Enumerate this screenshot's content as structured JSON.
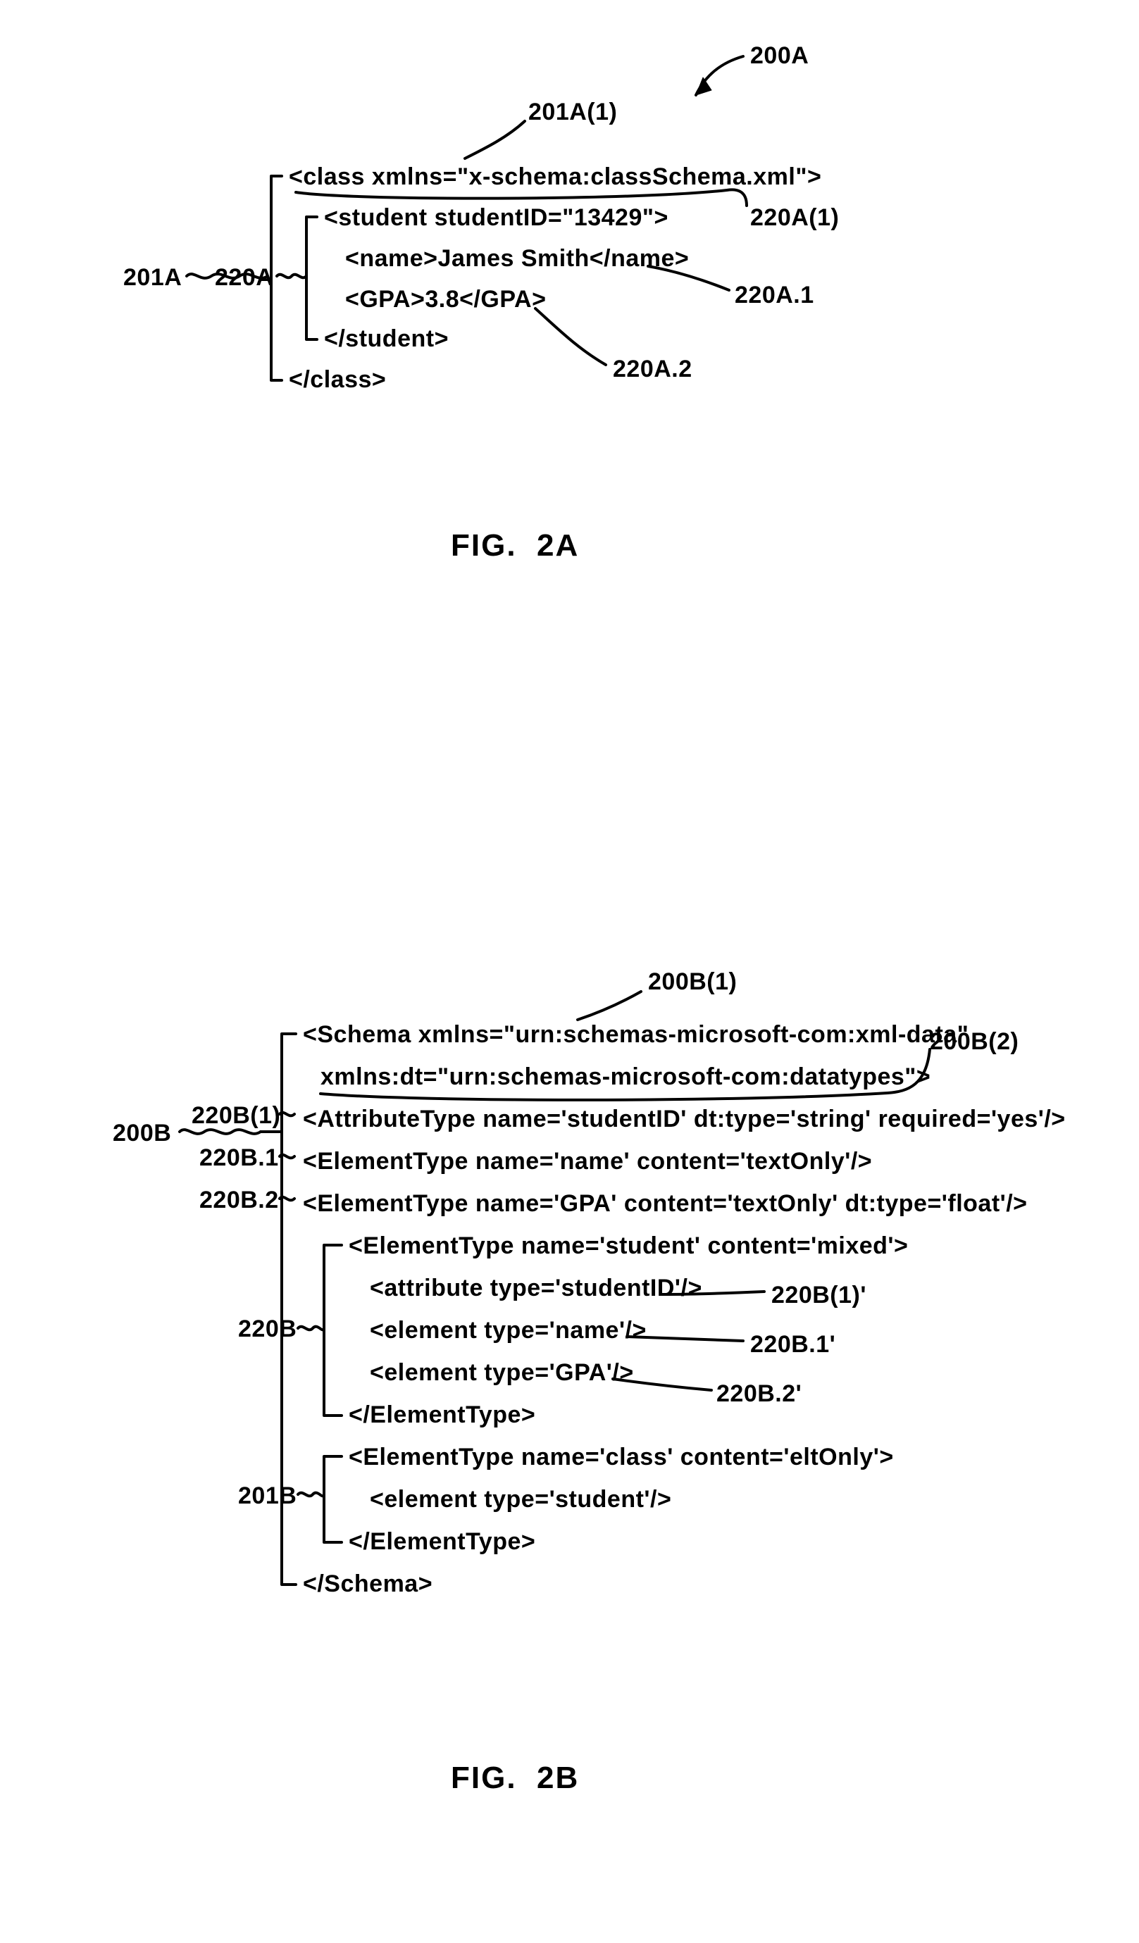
{
  "figA": {
    "caption": "FIG.  2A",
    "labels": {
      "l200A": "200A",
      "l201A1": "201A(1)",
      "l201A": "201A",
      "l220A": "220A",
      "l220A1p": "220A(1)",
      "l220A_1": "220A.1",
      "l220A_2": "220A.2"
    },
    "lines": {
      "open": "<class xmlns=\"x-schema:classSchema.xml\">",
      "studentOpen": "<student studentID=\"13429\">",
      "name": "<name>James Smith</name>",
      "gpa": "<GPA>3.8</GPA>",
      "studentClose": "</student>",
      "close": "</class>"
    }
  },
  "figB": {
    "caption": "FIG.  2B",
    "labels": {
      "l200B1": "200B(1)",
      "l200B2": "200B(2)",
      "l200B": "200B",
      "l220B1p": "220B(1)",
      "l220B_1": "220B.1",
      "l220B_2": "220B.2",
      "l220B": "220B",
      "l220B1pp": "220B(1)'",
      "l220B_1p": "220B.1'",
      "l220B_2p": "220B.2'",
      "l201B": "201B"
    },
    "lines": {
      "schemaOpen1": "<Schema xmlns=\"urn:schemas-microsoft-com:xml-data\"",
      "schemaOpen2": "xmlns:dt=\"urn:schemas-microsoft-com:datatypes\">",
      "attrType": "<AttributeType name='studentID' dt:type='string' required='yes'/>",
      "elemName": "<ElementType name='name' content='textOnly'/>",
      "elemGPA": "<ElementType name='GPA' content='textOnly' dt:type='float'/>",
      "studentOpen": "<ElementType name='student' content='mixed'>",
      "attrRef": "<attribute type='studentID'/>",
      "elemRefName": "<element type='name'/>",
      "elemRefGPA": "<element type='GPA'/>",
      "studentClose": "</ElementType>",
      "classOpen": "<ElementType name='class' content='eltOnly'>",
      "elemRefStudent": "<element type='student'/>",
      "classClose": "</ElementType>",
      "schemaClose": "</Schema>"
    }
  }
}
